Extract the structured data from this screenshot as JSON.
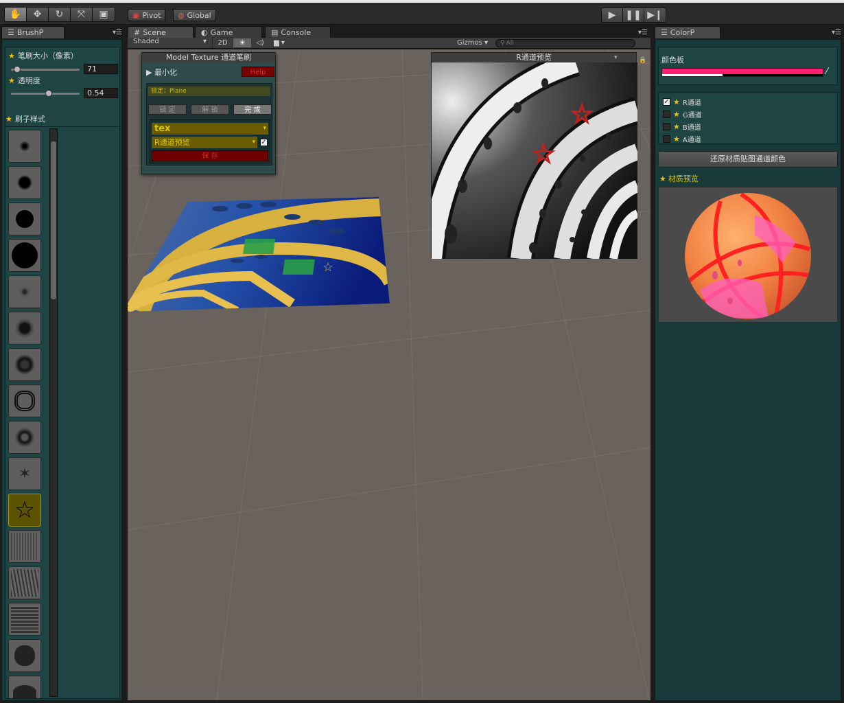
{
  "toolbar": {
    "tools": [
      "hand-tool",
      "move-tool",
      "rotate-tool",
      "scale-tool",
      "rect-tool"
    ],
    "pivot_label": "Pivot",
    "global_label": "Global",
    "play_icon": "play-icon",
    "pause_icon": "pause-icon",
    "step_icon": "step-icon"
  },
  "brush_panel": {
    "tab": "BrushP",
    "size_label": "笔刷大小（像素）",
    "size_value": "71",
    "size_fraction": 0.08,
    "opacity_label": "透明度",
    "opacity_value": "0.54",
    "opacity_fraction": 0.54,
    "styles_label": "刷子样式",
    "brushes": [
      "soft-small",
      "soft-medium",
      "hard-small",
      "hard-large",
      "splatter-1",
      "splatter-2",
      "splatter-3",
      "scribble",
      "flower",
      "sparkle",
      "star",
      "noise-1",
      "noise-2",
      "noise-3",
      "noise-4",
      "noise-5"
    ],
    "selected_brush": 10
  },
  "scene": {
    "tabs": [
      "Scene",
      "Game",
      "Console"
    ],
    "shading": "Shaded",
    "mode_2d": "2D",
    "gizmos": "Gizmos",
    "search_placeholder": "All"
  },
  "brush_window": {
    "title": "Model Texture 通道笔刷",
    "minimize": "最小化",
    "help": "Help",
    "locked": "锁定：Plane",
    "lock_btn": "锁 定",
    "unlock_btn": "解 锁",
    "done_btn": "完 成",
    "texture_select": "tex",
    "channel_select": "R通道预览",
    "save_btn": "保 存"
  },
  "preview_window": {
    "title": "R通道预览"
  },
  "color_panel": {
    "tab": "ColorP",
    "palette_label": "颜色板",
    "color": "#ff1f6f",
    "channels": [
      {
        "label": "R通道",
        "checked": true
      },
      {
        "label": "G通道",
        "checked": false
      },
      {
        "label": "B通道",
        "checked": false
      },
      {
        "label": "A通道",
        "checked": false
      }
    ],
    "restore_btn": "还原材质贴图通道颜色",
    "material_preview": "材质预览"
  }
}
